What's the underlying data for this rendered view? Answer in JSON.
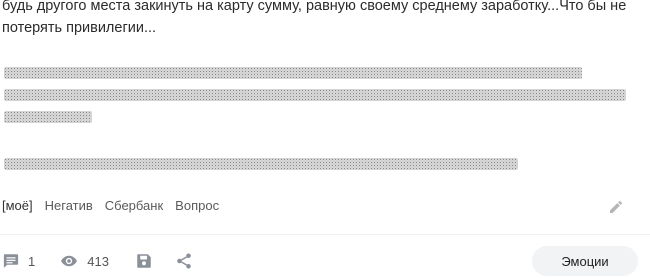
{
  "post": {
    "text_lines": [
      "будь другого места закинуть на карту сумму, равную своему среднему заработку...Что бы не",
      "потерять привилегии..."
    ]
  },
  "tags": [
    "[моё]",
    "Негатив",
    "Сбербанк",
    "Вопрос"
  ],
  "footer": {
    "comments_count": "1",
    "views_count": "413",
    "emotions_label": "Эмоции"
  }
}
